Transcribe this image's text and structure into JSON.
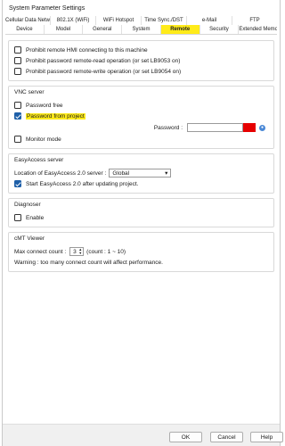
{
  "window": {
    "title": "System Parameter Settings"
  },
  "tabs": {
    "row1": [
      "Cellular Data Network",
      "802.1X (WiFi)",
      "WiFi Hotspot",
      "Time Sync./DST",
      "e-Mail",
      "FTP"
    ],
    "row2": [
      "Device",
      "Model",
      "General",
      "System",
      "Remote",
      "Security",
      "Extended Memory"
    ],
    "active": "Remote"
  },
  "top": {
    "prohibit_remote_hmi": "Prohibit remote HMI connecting to this machine",
    "prohibit_remote_read": "Prohibit password remote-read operation (or set LB9053 on)",
    "prohibit_remote_write": "Prohibit password remote-write operation (or set LB9054 on)"
  },
  "vnc": {
    "title": "VNC server",
    "password_free": "Password free",
    "password_from_project": "Password from project",
    "password_label": "Password :",
    "monitor_mode": "Monitor mode"
  },
  "easyaccess": {
    "title": "EasyAccess server",
    "location_label": "Location of EasyAccess 2.0 server :",
    "location_value": "Global",
    "start_after_update": "Start EasyAccess 2.0 after updating project."
  },
  "diagnoser": {
    "title": "Diagnoser",
    "enable": "Enable"
  },
  "cmt": {
    "title": "cMT Viewer",
    "max_label": "Max connect count :",
    "max_value": "3",
    "range": "(count : 1 ~ 10)",
    "warning": "Warning : too many connect count will affect performance."
  },
  "buttons": {
    "ok": "OK",
    "cancel": "Cancel",
    "help": "Help"
  },
  "colors": {
    "highlight": "#ffeb1a",
    "checkbox": "#1e5fa8",
    "red_marker": "#e60000"
  }
}
